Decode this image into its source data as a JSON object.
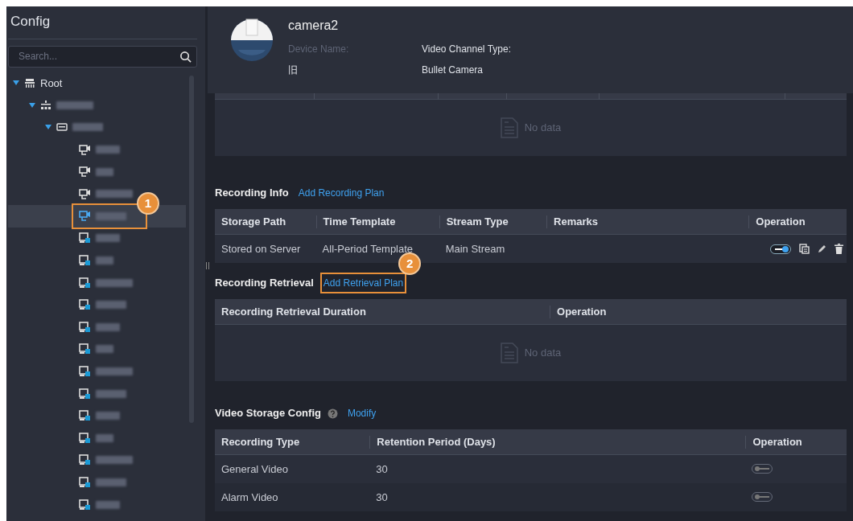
{
  "sidebar": {
    "title": "Config",
    "search": {
      "placeholder": "Search..."
    },
    "tree": [
      {
        "kind": "root",
        "label": "Root",
        "expanded": true,
        "selected": false,
        "children": [
          {
            "kind": "org",
            "expanded": true,
            "selected": false,
            "children": [
              {
                "kind": "device",
                "expanded": true,
                "selected": false,
                "children": [
                  {
                    "kind": "camera",
                    "selected": false
                  },
                  {
                    "kind": "camera",
                    "selected": false
                  },
                  {
                    "kind": "camera",
                    "selected": false
                  },
                  {
                    "kind": "camera",
                    "selected": true,
                    "callout": "1"
                  },
                  {
                    "kind": "alarm",
                    "selected": false
                  },
                  {
                    "kind": "alarm",
                    "selected": false
                  },
                  {
                    "kind": "alarm",
                    "selected": false
                  },
                  {
                    "kind": "alarm",
                    "selected": false
                  },
                  {
                    "kind": "alarm",
                    "selected": false
                  },
                  {
                    "kind": "alarm",
                    "selected": false
                  },
                  {
                    "kind": "alarm",
                    "selected": false
                  },
                  {
                    "kind": "alarm",
                    "selected": false
                  },
                  {
                    "kind": "alarm",
                    "selected": false
                  },
                  {
                    "kind": "alarm",
                    "selected": false
                  },
                  {
                    "kind": "alarm",
                    "selected": false
                  },
                  {
                    "kind": "alarm",
                    "selected": false
                  },
                  {
                    "kind": "alarm",
                    "selected": false
                  }
                ]
              }
            ]
          }
        ]
      }
    ]
  },
  "header": {
    "name": "camera2",
    "fields": [
      {
        "label": "Device Name:",
        "value": "旧"
      },
      {
        "label": "Video Channel Type:",
        "value": "Bullet Camera"
      }
    ]
  },
  "top_table": {
    "empty_text": "No data"
  },
  "recording_info": {
    "title": "Recording Info",
    "link": "Add Recording Plan",
    "columns": [
      "Storage Path",
      "Time Template",
      "Stream Type",
      "Remarks",
      "Operation"
    ],
    "rows": [
      {
        "cells": [
          "Stored on Server",
          "All-Period Template",
          "Main Stream",
          ""
        ],
        "on": true
      }
    ]
  },
  "recording_retrieval": {
    "title": "Recording Retrieval",
    "link": "Add Retrieval Plan",
    "link_callout": "2",
    "columns": [
      "Recording Retrieval Duration",
      "Operation"
    ],
    "empty_text": "No data"
  },
  "video_storage": {
    "title": "Video Storage Config",
    "link": "Modify",
    "columns": [
      "Recording Type",
      "Retention Period (Days)",
      "Operation"
    ],
    "rows": [
      {
        "cells": [
          "General Video",
          "30"
        ],
        "on": false
      },
      {
        "cells": [
          "Alarm Video",
          "30"
        ],
        "on": false
      }
    ]
  }
}
